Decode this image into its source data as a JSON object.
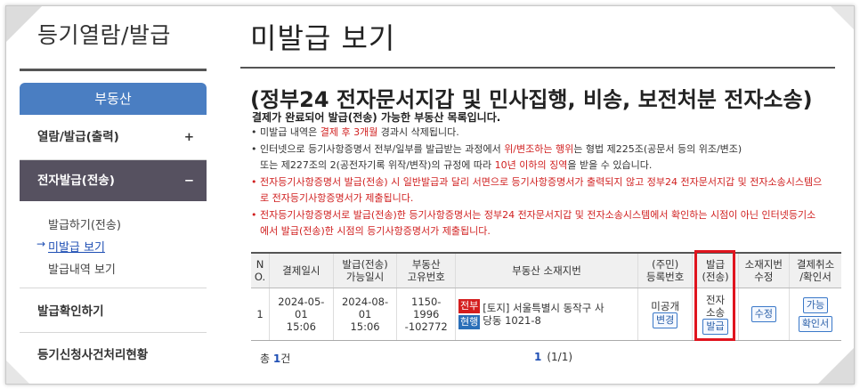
{
  "sidebar": {
    "title": "등기열람/발급",
    "category": "부동산",
    "menu": [
      {
        "label": "열람/발급(출력)",
        "toggle": "+"
      },
      {
        "label": "전자발급(전송)",
        "toggle": "−"
      }
    ],
    "submenu": [
      "발급하기(전송)",
      "미발급 보기",
      "발급내역 보기"
    ],
    "arrow": "→",
    "extra": [
      "발급확인하기",
      "등기신청사건처리현황"
    ]
  },
  "main": {
    "title": "미발급 보기",
    "heading": "(정부24 전자문서지갑 및 민사집행, 비송, 보전처분 전자소송)",
    "subtitle": "결제가 완료되어 발급(전송) 가능한 부동산 목록입니다.",
    "notes": {
      "n1_a": "미발급 내역은 ",
      "n1_b": "결제 후 3개월",
      "n1_c": " 경과시 삭제됩니다.",
      "n2_a": "인터넷으로 등기사항증명서 전부/일부를 발급받는 과정에서 ",
      "n2_b": "위/변조하는 행위",
      "n2_c": "는 형법 제225조(공문서 등의 위조/변조)",
      "n3_a": "또는 제227조의 2(공전자기록 위작/변작)의 규정에 따라 ",
      "n3_b": "10년 이하의 징역",
      "n3_c": "을 받을 수 있습니다.",
      "n4": "전자등기사항증명서 발급(전송) 시 일반발급과 달리 서면으로 등기사항증명서가 출력되지 않고 정부24 전자문서지갑 및 전자소송시스템으",
      "n5": "로 전자등기사항증명서가 제출됩니다.",
      "n6": "전자등기사항증명서로 발급(전송)한 등기사항증명서는 정부24 전자문서지갑 및 전자소송시스템에서 확인하는 시점이 아닌 인터넷등기소",
      "n7": "에서 발급(전송)한 시점의 등기사항증명서가 제출됩니다."
    },
    "table": {
      "headers": {
        "no_1": "N",
        "no_2": "O.",
        "paid": "결제일시",
        "avail_1": "발급(전송)",
        "avail_2": "가능일시",
        "unique_1": "부동산",
        "unique_2": "고유번호",
        "location": "부동산 소재지번",
        "reg_1": "(주민)",
        "reg_2": "등록번호",
        "issue_1": "발급",
        "issue_2": "(전송)",
        "edit_1": "소재지번",
        "edit_2": "수정",
        "cancel_1": "결제취소",
        "cancel_2": "/확인서"
      },
      "row": {
        "no": "1",
        "paid_date": "2024-05-01",
        "paid_time": "15:06",
        "avail_date": "2024-08-01",
        "avail_time": "15:06",
        "unique_1": "1150-1996",
        "unique_2": "-102772",
        "tag_full": "전부",
        "tag_current": "현행",
        "address_1": "[토지] 서울특별시 동작구 사",
        "address_2": "당동 1021-8",
        "reg_status": "미공개",
        "reg_btn": "변경",
        "issue_1": "전자",
        "issue_2": "소송",
        "issue_btn": "발급",
        "edit_btn": "수정",
        "cancel_btn": "가능",
        "confirm_btn": "확인서"
      }
    },
    "total_prefix": "총 ",
    "total_count": "1",
    "total_suffix": "건",
    "page_current": "1",
    "page_info": "(1/1)"
  },
  "colors": {
    "accent": "#4a7ec2",
    "active_menu": "#565160",
    "alert": "#d01f1f",
    "highlight": "#e0141e"
  }
}
